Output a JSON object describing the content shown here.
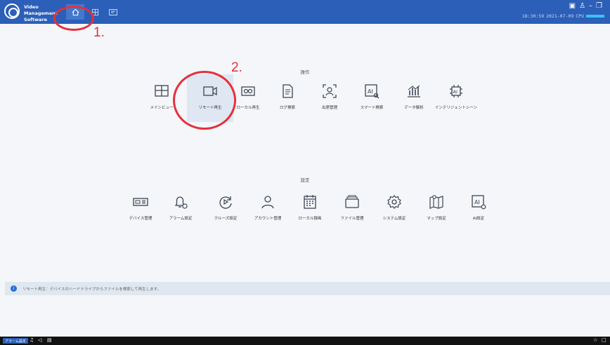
{
  "app": {
    "name_line1": "Video Management",
    "name_line2": "Software"
  },
  "titlebar": {
    "nav": [
      {
        "icon": "home-icon",
        "active": true
      },
      {
        "icon": "grid-icon",
        "active": false
      },
      {
        "icon": "device-panel-icon",
        "active": false
      }
    ],
    "controls": [
      "monitor-icon",
      "user-icon",
      "minimize-icon",
      "restore-icon",
      "close-icon"
    ],
    "time": "18:30:59",
    "date": "2021-07-09",
    "cpu_label": "CPU"
  },
  "annotations": {
    "step1": "1.",
    "step2": "2."
  },
  "operation": {
    "title": "操作",
    "items": [
      {
        "label": "メインビュー",
        "icon": "main-view-icon",
        "active": false
      },
      {
        "label": "リモート再生",
        "icon": "remote-playback-icon",
        "active": true
      },
      {
        "label": "ローカル再生",
        "icon": "local-playback-icon",
        "active": false
      },
      {
        "label": "ログ検索",
        "icon": "log-search-icon",
        "active": false
      },
      {
        "label": "出席管理",
        "icon": "attendance-icon",
        "active": false
      },
      {
        "label": "スマート検索",
        "icon": "ai-search-icon",
        "active": false
      },
      {
        "label": "データ解析",
        "icon": "data-analysis-icon",
        "active": false
      },
      {
        "label": "インテリジェントシーン",
        "icon": "intelligent-scene-icon",
        "active": false
      }
    ]
  },
  "settings": {
    "title": "設定",
    "items": [
      {
        "label": "デバイス管理",
        "icon": "device-management-icon"
      },
      {
        "label": "アラーム設定",
        "icon": "alarm-settings-icon"
      },
      {
        "label": "クルーズ設定",
        "icon": "cruise-settings-icon"
      },
      {
        "label": "アカウント管理",
        "icon": "account-icon"
      },
      {
        "label": "ローカル録画",
        "icon": "local-recording-icon"
      },
      {
        "label": "ファイル管理",
        "icon": "file-management-icon"
      },
      {
        "label": "システム設定",
        "icon": "system-settings-icon"
      },
      {
        "label": "マップ設定",
        "icon": "map-settings-icon"
      },
      {
        "label": "AI設定",
        "icon": "ai-settings-icon"
      }
    ]
  },
  "info": {
    "text": "リモート再生：デバイスのハードドライブからファイルを検索して再生します。"
  },
  "statusbar": {
    "alarm_label": "アラーム設定"
  },
  "colors": {
    "titlebar": "#2b5fb8",
    "accent": "#2b6fd6",
    "annotation": "#e5303b"
  }
}
